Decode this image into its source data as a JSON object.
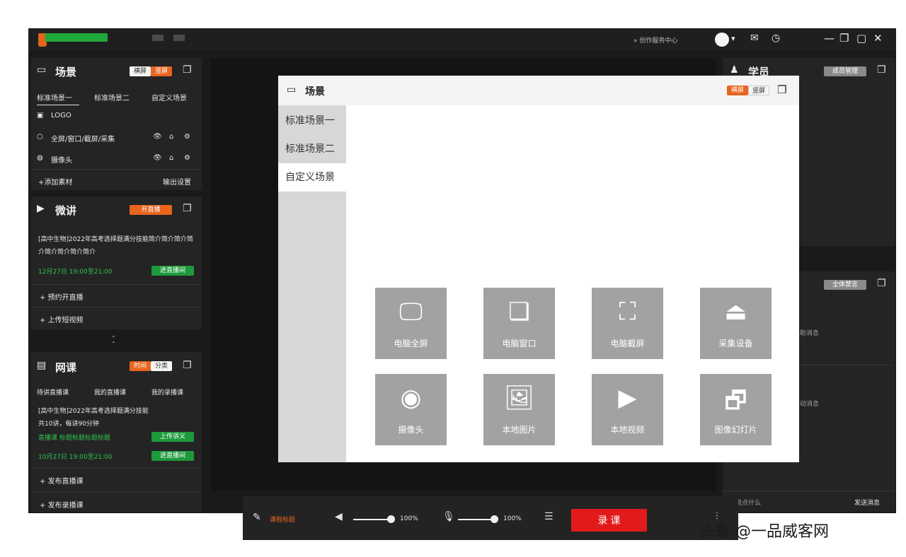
{
  "topbar": {
    "center_link": "» 创作服务中心",
    "icons": [
      "avatar-icon",
      "mail-icon",
      "clock-icon"
    ],
    "window_controls": [
      "minimize-icon",
      "restore-icon",
      "maximize-icon",
      "close-icon"
    ],
    "glyphs": {
      "caret": "▾",
      "mail": "✉",
      "clock": "◷",
      "min": "—",
      "restore": "❐",
      "max": "▢",
      "close": "✕"
    }
  },
  "scene_panel": {
    "title": "场景",
    "toggle": [
      "横屏",
      "竖屏"
    ],
    "tabs": [
      "标准场景一",
      "标准场景二",
      "自定义场景"
    ],
    "sources": [
      {
        "label": "LOGO"
      },
      {
        "label": "全屏/窗口/截屏/采集"
      },
      {
        "label": "摄像头"
      }
    ],
    "add_material": "+添加素材",
    "output_settings": "输出设置"
  },
  "talk_panel": {
    "title": "微讲",
    "start_button": "开直播",
    "course_desc": "[高中生物]2022年高考选择题满分技能简介简介简介简介简介简介简介简介",
    "time": "12月27日  19:00至21:00",
    "enter_button": "进直播间",
    "actions": [
      "+ 预约开直播",
      "+ 上传短视频"
    ]
  },
  "class_panel": {
    "title": "网课",
    "toggle": [
      "时间",
      "分类"
    ],
    "tabs": [
      "待讲直播课",
      "我的直播课",
      "我的录播课"
    ],
    "course_desc_1": "[高中生物]2022年高考选择题满分技能",
    "course_desc_2": "共10讲，每讲90分钟",
    "tags": "直播课  标题标题标题标题",
    "upload_button": "上传讲义",
    "time": "10月27日  19:00至21:00",
    "enter_button": "进直播间",
    "actions": [
      "+ 发布直播课",
      "+ 发布录播课"
    ]
  },
  "right_panel": {
    "students_title": "学员",
    "students_button": "成员管理",
    "chat_button": "全体禁言",
    "chat_notice_1": "天助消息",
    "chat_notice_2": "互动消息",
    "input_placeholder": "说点什么",
    "send_button": "发送消息"
  },
  "modal": {
    "title": "场景",
    "toggle": [
      "横屏",
      "竖屏"
    ],
    "side_items": [
      "标准场景一",
      "标准场景二",
      "自定义场景"
    ],
    "active_item": "自定义场景",
    "tiles": [
      {
        "label": "电脑全屏",
        "icon": "monitor-icon",
        "glyph": "🖵"
      },
      {
        "label": "电脑窗口",
        "icon": "window-icon",
        "glyph": "❏"
      },
      {
        "label": "电脑截屏",
        "icon": "screenshot-icon",
        "glyph": "⛶"
      },
      {
        "label": "采集设备",
        "icon": "capture-device-icon",
        "glyph": "⏏"
      },
      {
        "label": "摄像头",
        "icon": "webcam-icon",
        "glyph": "◉"
      },
      {
        "label": "本地图片",
        "icon": "image-icon",
        "glyph": "🖼"
      },
      {
        "label": "本地视频",
        "icon": "video-icon",
        "glyph": "▶"
      },
      {
        "label": "图像幻灯片",
        "icon": "slideshow-icon",
        "glyph": "🗗"
      }
    ]
  },
  "bottombar": {
    "edit_title": "课程标题",
    "volume_pct": "100%",
    "volume_level": 1.0,
    "mic_pct": "100%",
    "mic_level": 1.0,
    "record_button": "录 课"
  },
  "watermark": "头条 @一品威客网",
  "colors": {
    "accent": "#e9641d",
    "record": "#e11b1b",
    "green": "#1d9a3c"
  }
}
